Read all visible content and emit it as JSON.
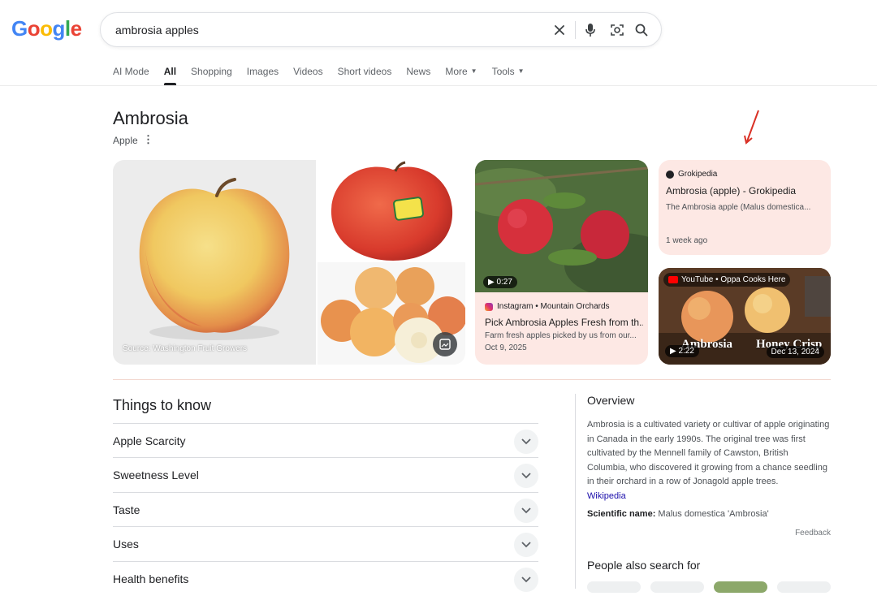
{
  "logo": {
    "letters": [
      "G",
      "o",
      "o",
      "g",
      "l",
      "e"
    ]
  },
  "search": {
    "value": "ambrosia apples"
  },
  "tabs": [
    {
      "label": "AI Mode"
    },
    {
      "label": "All"
    },
    {
      "label": "Shopping"
    },
    {
      "label": "Images"
    },
    {
      "label": "Videos"
    },
    {
      "label": "Short videos"
    },
    {
      "label": "News"
    },
    {
      "label": "More"
    },
    {
      "label": "Tools"
    }
  ],
  "knowledge_panel": {
    "title": "Ambrosia",
    "subtitle": "Apple",
    "image_source": "Source: Washington Fruit Growers"
  },
  "cards": {
    "instagram": {
      "duration": "0:27",
      "source": "Instagram • Mountain Orchards",
      "title": "Pick Ambrosia Apples Fresh from th...",
      "description": "Farm fresh apples picked by us from our...",
      "date": "Oct 9, 2025"
    },
    "grokipedia": {
      "source": "Grokipedia",
      "title": "Ambrosia (apple) - Grokipedia",
      "description": "The Ambrosia apple (Malus domestica...",
      "date": "1 week ago"
    },
    "youtube": {
      "source": "YouTube • Oppa Cooks Here",
      "duration": "2:22",
      "date": "Dec 13, 2024",
      "overlay_left": "Ambrosia",
      "overlay_right": "Honey Crisp"
    }
  },
  "things_to_know": {
    "title": "Things to know",
    "items": [
      {
        "label": "Apple Scarcity"
      },
      {
        "label": "Sweetness Level"
      },
      {
        "label": "Taste"
      },
      {
        "label": "Uses"
      },
      {
        "label": "Health benefits"
      }
    ]
  },
  "overview": {
    "title": "Overview",
    "text": "Ambrosia is a cultivated variety or cultivar of apple originating in Canada in the early 1990s. The original tree was first cultivated by the Mennell family of Cawston, British Columbia, who discovered it growing from a chance seedling in their orchard in a row of Jonagold apple trees.",
    "link": "Wikipedia",
    "sci_label": "Scientific name:",
    "sci_value": "Malus domestica 'Ambrosia'",
    "feedback": "Feedback",
    "people_also_search": "People also search for"
  },
  "colors": {
    "arrow": "#d93025",
    "card_bg": "#fde8e4",
    "link": "#1a0dab"
  }
}
